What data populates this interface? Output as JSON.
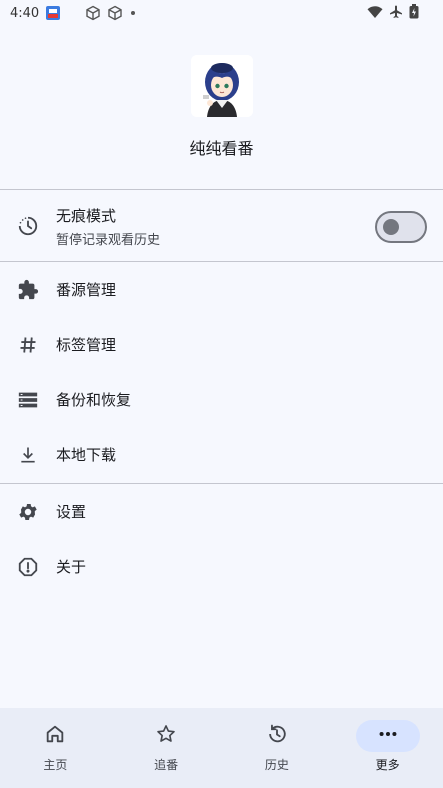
{
  "status_bar": {
    "time": "4:40"
  },
  "header": {
    "app_name": "纯纯看番"
  },
  "incognito": {
    "title": "无痕模式",
    "subtitle": "暂停记录观看历史",
    "enabled": false
  },
  "menu": {
    "items": [
      {
        "label": "番源管理",
        "icon": "puzzle-icon"
      },
      {
        "label": "标签管理",
        "icon": "hash-icon"
      },
      {
        "label": "备份和恢复",
        "icon": "storage-icon"
      },
      {
        "label": "本地下载",
        "icon": "download-icon"
      },
      {
        "label": "设置",
        "icon": "gear-icon"
      },
      {
        "label": "关于",
        "icon": "info-icon"
      }
    ]
  },
  "bottom_nav": {
    "items": [
      {
        "label": "主页",
        "icon": "home-icon"
      },
      {
        "label": "追番",
        "icon": "star-icon"
      },
      {
        "label": "历史",
        "icon": "history-icon"
      },
      {
        "label": "更多",
        "icon": "more-icon",
        "active": true
      }
    ]
  },
  "colors": {
    "background": "#f6f8fe",
    "nav_background": "#e9edf7",
    "active_pill": "#d7e3ff",
    "divider": "#c4c6cf"
  }
}
